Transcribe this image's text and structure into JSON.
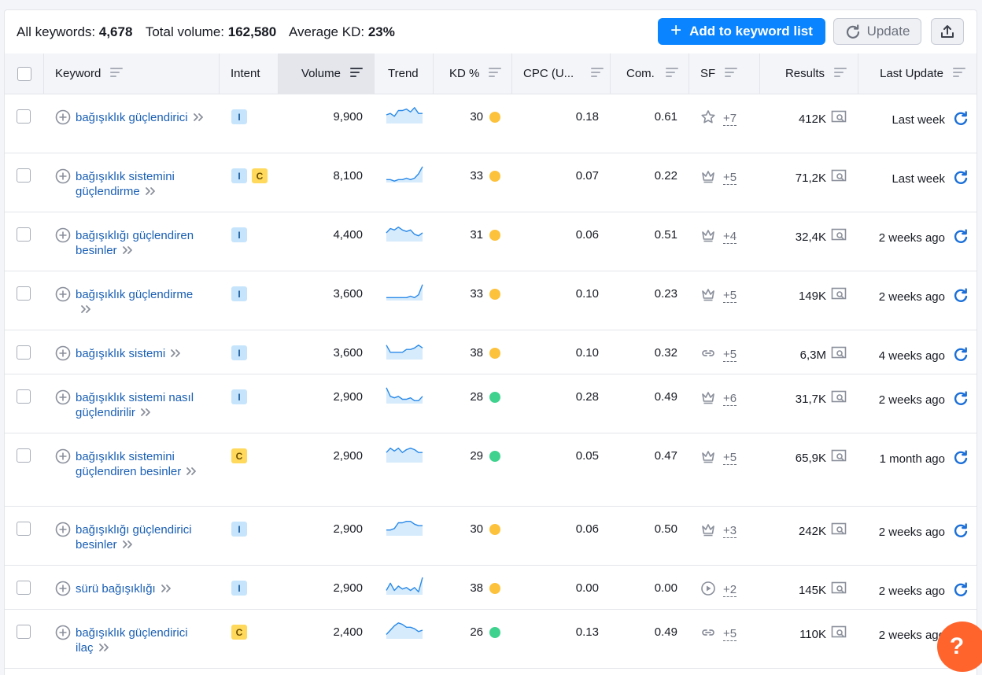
{
  "stats": {
    "all_keywords_label": "All keywords:",
    "all_keywords_value": "4,678",
    "total_volume_label": "Total volume:",
    "total_volume_value": "162,580",
    "avg_kd_label": "Average KD:",
    "avg_kd_value": "23%"
  },
  "toolbar": {
    "add_label": "Add to keyword list",
    "update_label": "Update"
  },
  "columns": {
    "keyword": "Keyword",
    "intent": "Intent",
    "volume": "Volume",
    "trend": "Trend",
    "kd": "KD %",
    "cpc": "CPC (U...",
    "com": "Com.",
    "sf": "SF",
    "results": "Results",
    "last_update": "Last Update"
  },
  "colors": {
    "accent": "#0a84ff",
    "kw_link": "#1a5fb4",
    "kd_yellow": "#fdc23c",
    "kd_green": "#3fd28e",
    "help": "#ff642d"
  },
  "rows": [
    {
      "keyword": "bağışıklık güçlendirici",
      "lines": 2,
      "intent": [
        "I"
      ],
      "volume": "9,900",
      "trend": [
        6,
        7,
        5,
        9,
        9,
        10,
        8,
        11,
        7,
        7
      ],
      "kd": "30",
      "kd_color": "#fdc23c",
      "cpc": "0.18",
      "com": "0.61",
      "sf_icon": "star-icon",
      "sf_more": "+7",
      "results": "412K",
      "last_update": "Last week"
    },
    {
      "keyword": "bağışıklık sistemini güçlendirme",
      "lines": 2,
      "intent": [
        "I",
        "C"
      ],
      "volume": "8,100",
      "trend": [
        2,
        2,
        1,
        2,
        2,
        3,
        2,
        3,
        6,
        11
      ],
      "kd": "33",
      "kd_color": "#fdc23c",
      "cpc": "0.07",
      "com": "0.22",
      "sf_icon": "crown-icon",
      "sf_more": "+5",
      "results": "71,2K",
      "last_update": "Last week"
    },
    {
      "keyword": "bağışıklığı güçlendiren besinler",
      "lines": 2,
      "intent": [
        "I"
      ],
      "volume": "4,400",
      "trend": [
        6,
        9,
        8,
        10,
        8,
        7,
        8,
        5,
        4,
        6
      ],
      "kd": "31",
      "kd_color": "#fdc23c",
      "cpc": "0.06",
      "com": "0.51",
      "sf_icon": "crown-icon",
      "sf_more": "+4",
      "results": "32,4K",
      "last_update": "2 weeks ago"
    },
    {
      "keyword": "bağışıklık güçlendirme",
      "lines": 2,
      "intent": [
        "I"
      ],
      "volume": "3,600",
      "trend": [
        2,
        2,
        2,
        2,
        2,
        2,
        3,
        2,
        4,
        11
      ],
      "kd": "33",
      "kd_color": "#fdc23c",
      "cpc": "0.10",
      "com": "0.23",
      "sf_icon": "crown-icon",
      "sf_more": "+5",
      "results": "149K",
      "last_update": "2 weeks ago"
    },
    {
      "keyword": "bağışıklık sistemi",
      "lines": 1,
      "intent": [
        "I"
      ],
      "volume": "3,600",
      "trend": [
        10,
        5,
        5,
        5,
        5,
        7,
        7,
        8,
        10,
        8
      ],
      "kd": "38",
      "kd_color": "#fdc23c",
      "cpc": "0.10",
      "com": "0.32",
      "sf_icon": "link-icon",
      "sf_more": "+5",
      "results": "6,3M",
      "last_update": "4 weeks ago"
    },
    {
      "keyword": "bağışıklık sistemi nasıl güçlendirilir",
      "lines": 2,
      "intent": [
        "I"
      ],
      "volume": "2,900",
      "trend": [
        11,
        5,
        4,
        5,
        3,
        3,
        4,
        2,
        2,
        5
      ],
      "kd": "28",
      "kd_color": "#3fd28e",
      "cpc": "0.28",
      "com": "0.49",
      "sf_icon": "crown-icon",
      "sf_more": "+6",
      "results": "31,7K",
      "last_update": "2 weeks ago"
    },
    {
      "keyword": "bağışıklık sistemini güçlendiren besinler",
      "lines": 3,
      "intent": [
        "C"
      ],
      "volume": "2,900",
      "trend": [
        7,
        10,
        8,
        10,
        7,
        9,
        10,
        9,
        7,
        7
      ],
      "kd": "29",
      "kd_color": "#3fd28e",
      "cpc": "0.05",
      "com": "0.47",
      "sf_icon": "crown-icon",
      "sf_more": "+5",
      "results": "65,9K",
      "last_update": "1 month ago"
    },
    {
      "keyword": "bağışıklığı güçlendirici besinler",
      "lines": 2,
      "intent": [
        "I"
      ],
      "volume": "2,900",
      "trend": [
        4,
        4,
        5,
        9,
        9,
        10,
        10,
        8,
        7,
        7
      ],
      "kd": "30",
      "kd_color": "#fdc23c",
      "cpc": "0.06",
      "com": "0.50",
      "sf_icon": "crown-icon",
      "sf_more": "+3",
      "results": "242K",
      "last_update": "2 weeks ago"
    },
    {
      "keyword": "sürü bağışıklığı",
      "lines": 1,
      "intent": [
        "I"
      ],
      "volume": "2,900",
      "trend": [
        3,
        8,
        3,
        6,
        4,
        5,
        3,
        5,
        2,
        12
      ],
      "kd": "38",
      "kd_color": "#fdc23c",
      "cpc": "0.00",
      "com": "0.00",
      "sf_icon": "play-icon",
      "sf_more": "+2",
      "results": "145K",
      "last_update": "2 weeks ago"
    },
    {
      "keyword": "bağışıklık güçlendirici ilaç",
      "lines": 2,
      "intent": [
        "C"
      ],
      "volume": "2,400",
      "trend": [
        3,
        6,
        9,
        11,
        10,
        8,
        8,
        7,
        5,
        6
      ],
      "kd": "26",
      "kd_color": "#3fd28e",
      "cpc": "0.13",
      "com": "0.49",
      "sf_icon": "link-icon",
      "sf_more": "+5",
      "results": "110K",
      "last_update": "2 weeks ago"
    }
  ],
  "help_label": "?"
}
